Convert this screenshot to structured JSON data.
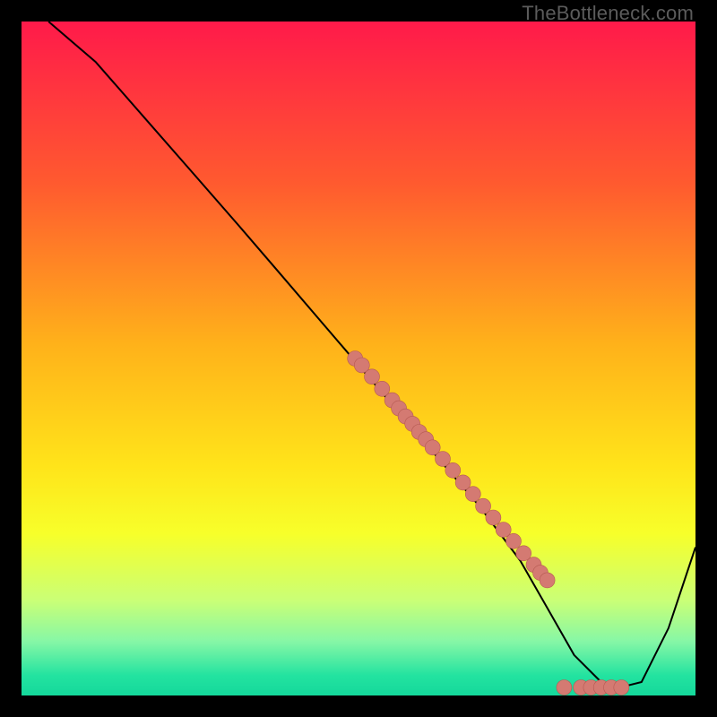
{
  "watermark": "TheBottleneck.com",
  "colors": {
    "frame": "#000000",
    "curve": "#000000",
    "marker_fill": "#d47a72",
    "marker_stroke": "#b55a52",
    "gradient_stops": [
      {
        "offset": 0.0,
        "color": "#ff1a4a"
      },
      {
        "offset": 0.24,
        "color": "#ff5a2f"
      },
      {
        "offset": 0.48,
        "color": "#ffb21a"
      },
      {
        "offset": 0.66,
        "color": "#ffe41a"
      },
      {
        "offset": 0.76,
        "color": "#f7ff2a"
      },
      {
        "offset": 0.86,
        "color": "#c9ff77"
      },
      {
        "offset": 0.92,
        "color": "#86f7a6"
      },
      {
        "offset": 0.97,
        "color": "#23e3a0"
      },
      {
        "offset": 1.0,
        "color": "#14d89b"
      }
    ]
  },
  "chart_data": {
    "type": "line",
    "title": "",
    "xlabel": "",
    "ylabel": "",
    "xlim": [
      0,
      100
    ],
    "ylim": [
      0,
      100
    ],
    "grid": false,
    "legend": false,
    "series": [
      {
        "name": "curve",
        "x": [
          4,
          11,
          18,
          25,
          32,
          38,
          44,
          50,
          56,
          62,
          68,
          74,
          78,
          82,
          86,
          88,
          92,
          96,
          100
        ],
        "y": [
          100,
          94,
          86,
          78,
          70,
          63,
          56,
          49,
          42,
          35,
          28,
          20,
          13,
          6,
          2,
          1,
          2,
          10,
          22
        ]
      }
    ],
    "markers": {
      "name": "highlight-points",
      "x": [
        49.5,
        50.5,
        52.0,
        53.5,
        55.0,
        56.0,
        57.0,
        58.0,
        59.0,
        60.0,
        61.0,
        62.5,
        64.0,
        65.5,
        67.0,
        68.5,
        70.0,
        71.5,
        73.0,
        74.5,
        76.0,
        77.0,
        78.0,
        80.5,
        83.0,
        84.5,
        86.0,
        87.5,
        89.0
      ],
      "y": [
        50.0,
        49.0,
        47.3,
        45.5,
        43.8,
        42.6,
        41.4,
        40.3,
        39.1,
        38.0,
        36.8,
        35.1,
        33.4,
        31.6,
        29.9,
        28.1,
        26.4,
        24.6,
        22.9,
        21.1,
        19.4,
        18.2,
        17.1,
        1.2,
        1.2,
        1.2,
        1.2,
        1.2,
        1.2
      ]
    }
  }
}
